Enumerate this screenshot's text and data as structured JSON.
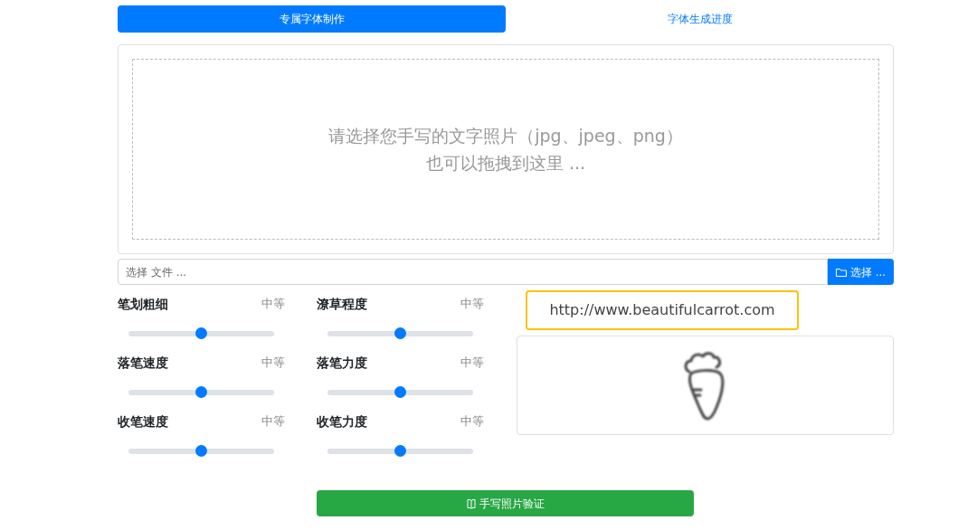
{
  "tabs": [
    {
      "label": "专属字体制作",
      "selected": true
    },
    {
      "label": "字体生成进度",
      "selected": false
    }
  ],
  "dropzone": {
    "lines": [
      "请选择您手写的文字照片（jpg、jpeg、png）",
      "也可以拖拽到这里 ..."
    ]
  },
  "file_input": {
    "placeholder": "选择 文件 ...",
    "button": "选择 ..."
  },
  "sliders": [
    {
      "name": "笔划粗细",
      "reading": "中等",
      "level": 0.5
    },
    {
      "name": "潦草程度",
      "reading": "中等",
      "level": 0.5
    },
    {
      "name": "落笔速度",
      "reading": "中等",
      "level": 0.5
    },
    {
      "name": "落笔力度",
      "reading": "中等",
      "level": 0.5
    },
    {
      "name": "收笔速度",
      "reading": "中等",
      "level": 0.5
    },
    {
      "name": "收笔力度",
      "reading": "中等",
      "level": 0.5
    }
  ],
  "preview": {
    "url": "http://www.beautifulcarrot.com"
  },
  "submit_button": "手写照片验证"
}
